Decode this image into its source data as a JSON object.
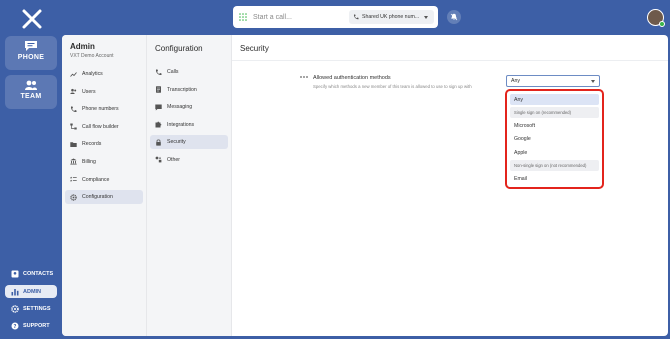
{
  "rail": {
    "phone_label": "PHONE",
    "team_label": "TEAM",
    "contacts_label": "CONTACTS",
    "admin_label": "ADMIN",
    "settings_label": "SETTINGS",
    "support_label": "SUPPORT"
  },
  "topbar": {
    "call_placeholder": "Start a call...",
    "phone_select": "Shared UK phone num..."
  },
  "admin": {
    "title": "Admin",
    "account": "VXT Demo Account",
    "items": [
      {
        "label": "Analytics"
      },
      {
        "label": "Users"
      },
      {
        "label": "Phone numbers"
      },
      {
        "label": "Call flow builder"
      },
      {
        "label": "Records"
      },
      {
        "label": "Billing"
      },
      {
        "label": "Compliance"
      },
      {
        "label": "Configuration"
      }
    ]
  },
  "configuration": {
    "title": "Configuration",
    "items": [
      {
        "label": "Calls"
      },
      {
        "label": "Transcription"
      },
      {
        "label": "Messaging"
      },
      {
        "label": "Integrations"
      },
      {
        "label": "Security"
      },
      {
        "label": "Other"
      }
    ]
  },
  "security": {
    "title": "Security",
    "setting_label": "Allowed authentication methods",
    "setting_desc": "Specify which methods a new member of this team is allowed to use to sign up with",
    "selected_value": "Any",
    "options": [
      {
        "label": "Any"
      },
      {
        "label": "Single sign on (recommended)"
      },
      {
        "label": "Microsoft"
      },
      {
        "label": "Google"
      },
      {
        "label": "Apple"
      },
      {
        "label": "Non-single sign on (not recommended)"
      },
      {
        "label": "Email"
      }
    ]
  },
  "colors": {
    "brand_blue": "#3d5fa6",
    "highlight_red": "#e3241c",
    "status_green": "#3bb54a"
  }
}
